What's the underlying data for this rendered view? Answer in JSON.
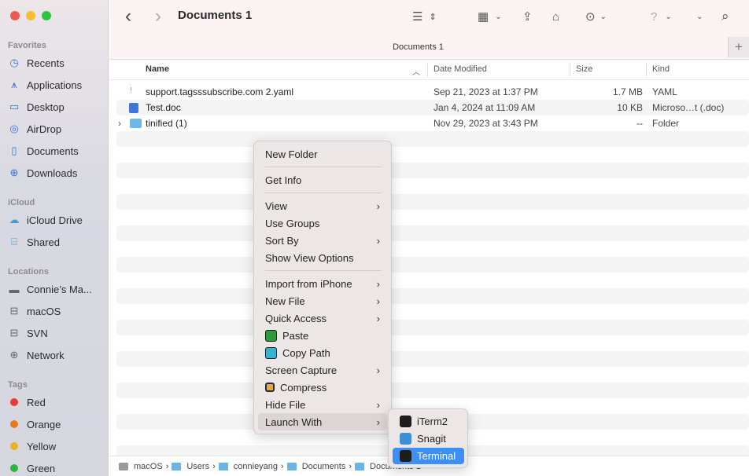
{
  "window": {
    "title": "Documents 1",
    "tab_label": "Documents 1"
  },
  "traffic_lights": {
    "close": "#ee5a52",
    "minimize": "#f5bd2f",
    "zoom": "#2fc63f"
  },
  "sidebar": {
    "favorites_header": "Favorites",
    "favorites": [
      {
        "label": "Recents",
        "icon": "clock-icon"
      },
      {
        "label": "Applications",
        "icon": "applications-icon"
      },
      {
        "label": "Desktop",
        "icon": "desktop-icon"
      },
      {
        "label": "AirDrop",
        "icon": "airdrop-icon"
      },
      {
        "label": "Documents",
        "icon": "document-icon"
      },
      {
        "label": "Downloads",
        "icon": "download-icon"
      }
    ],
    "icloud_header": "iCloud",
    "icloud": [
      {
        "label": "iCloud Drive",
        "icon": "cloud-icon"
      },
      {
        "label": "Shared",
        "icon": "shared-folder-icon"
      }
    ],
    "locations_header": "Locations",
    "locations": [
      {
        "label": "Connie’s Ma...",
        "icon": "laptop-icon"
      },
      {
        "label": "macOS",
        "icon": "disk-icon"
      },
      {
        "label": "SVN",
        "icon": "network-disk-icon"
      },
      {
        "label": "Network",
        "icon": "globe-icon"
      }
    ],
    "tags_header": "Tags",
    "tags": [
      {
        "label": "Red",
        "color": "#ea3a35"
      },
      {
        "label": "Orange",
        "color": "#e77a1e"
      },
      {
        "label": "Yellow",
        "color": "#e9b324"
      },
      {
        "label": "Green",
        "color": "#2bb73b"
      }
    ]
  },
  "toolbar": {
    "back": "‹",
    "forward": "›",
    "icons": [
      "list-view-icon",
      "grid-view-icon",
      "share-icon",
      "tag-icon",
      "more-actions-icon",
      "help-icon",
      "search-icon"
    ]
  },
  "columns": {
    "name": "Name",
    "date": "Date Modified",
    "size": "Size",
    "kind": "Kind"
  },
  "files": [
    {
      "name": "support.tagsssubscribe.com 2.yaml",
      "date": "Sep 21, 2023 at 1:37 PM",
      "size": "1.7 MB",
      "kind": "YAML",
      "icon": "yaml-file-icon"
    },
    {
      "name": "Test.doc",
      "date": "Jan 4, 2024 at 11:09 AM",
      "size": "10 KB",
      "kind": "Microso…t (.doc)",
      "icon": "word-file-icon"
    },
    {
      "name": "tinified (1)",
      "date": "Nov 29, 2023 at 3:43 PM",
      "size": "--",
      "kind": "Folder",
      "icon": "folder-icon"
    }
  ],
  "context_menu": {
    "items": [
      "New Folder",
      "Get Info",
      "View",
      "Use Groups",
      "Sort By",
      "Show View Options",
      "Import from iPhone",
      "New File",
      "Quick Access",
      "Paste",
      "Copy Path",
      "Screen Capture",
      "Compress",
      "Hide File",
      "Launch With"
    ],
    "submenu_arrow": "›"
  },
  "launch_with_submenu": {
    "items": [
      "iTerm2",
      "Snagit",
      "Terminal"
    ],
    "selected": "Terminal"
  },
  "pathbar": {
    "items": [
      "macOS",
      "Users",
      "connieyang",
      "Documents",
      "Documents 1"
    ],
    "separator": "›"
  }
}
